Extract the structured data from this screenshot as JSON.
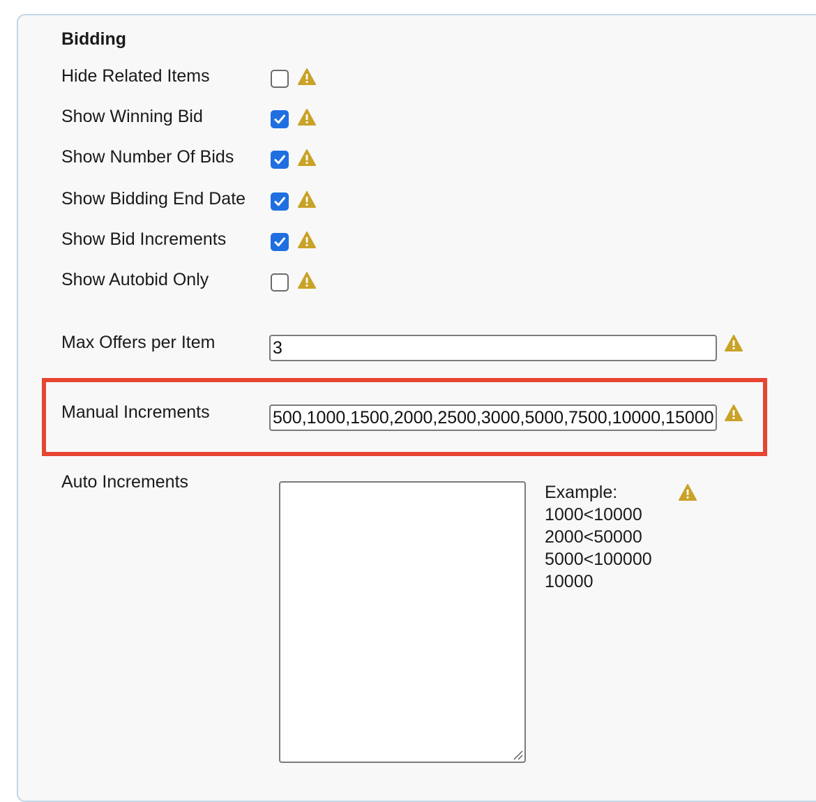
{
  "section": {
    "title": "Bidding"
  },
  "checkbox_rows": [
    {
      "label": "Hide Related Items",
      "checked": false
    },
    {
      "label": "Show Winning Bid",
      "checked": true
    },
    {
      "label": "Show Number Of Bids",
      "checked": true
    },
    {
      "label": "Show Bidding End Date",
      "checked": true
    },
    {
      "label": "Show Bid Increments",
      "checked": true
    },
    {
      "label": "Show Autobid Only",
      "checked": false
    }
  ],
  "max_offers": {
    "label": "Max Offers per Item",
    "value": "3"
  },
  "manual_increments": {
    "label": "Manual Increments",
    "value": "500,1000,1500,2000,2500,3000,5000,7500,10000,15000"
  },
  "auto_increments": {
    "label": "Auto Increments",
    "value": "",
    "example_heading": "Example:",
    "example_lines": [
      "1000<10000",
      "2000<50000",
      "5000<100000",
      "10000"
    ]
  },
  "colors": {
    "checkbox_checked": "#1f6fe0",
    "warning_icon": "#c9a227",
    "highlight_border": "#e64531",
    "panel_border": "#c2d6e6"
  },
  "icons": {
    "warning": "warning-triangle-icon",
    "checkmark": "checkmark-icon",
    "resize": "resize-grip-icon"
  }
}
